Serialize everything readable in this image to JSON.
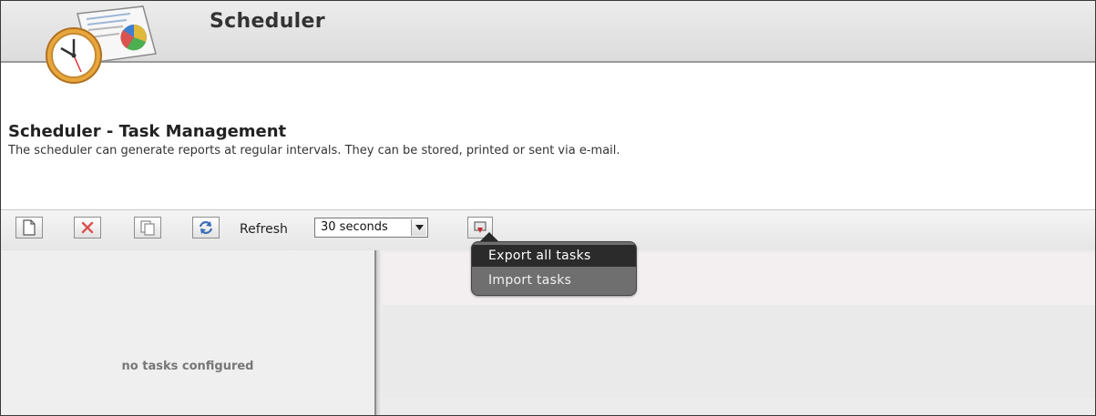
{
  "header": {
    "title": "Scheduler",
    "icon": "clock-report-icon"
  },
  "description": {
    "title": "Scheduler - Task Management",
    "text": "The scheduler can generate reports at regular intervals. They can be stored, printed or sent via e-mail."
  },
  "toolbar": {
    "buttons": [
      {
        "name": "new-task-button",
        "icon": "new-document-icon"
      },
      {
        "name": "delete-task-button",
        "icon": "delete-x-icon"
      },
      {
        "name": "copy-task-button",
        "icon": "copy-icon"
      },
      {
        "name": "refresh-button",
        "icon": "refresh-icon"
      }
    ],
    "refresh_label": "Refresh",
    "refresh_interval": "30 seconds",
    "import_export_icon": "import-export-icon"
  },
  "popup_menu": {
    "items": [
      {
        "label": "Export all tasks",
        "active": true
      },
      {
        "label": "Import tasks",
        "active": false
      }
    ]
  },
  "task_list": {
    "empty_text": "no tasks configured"
  },
  "colors": {
    "delete_icon": "#d9534f",
    "refresh_icon": "#3b6fb5",
    "import_export_icon": "#c62828",
    "menu_bg": "#6f6f6f",
    "menu_active_bg": "#2b2b2b"
  }
}
